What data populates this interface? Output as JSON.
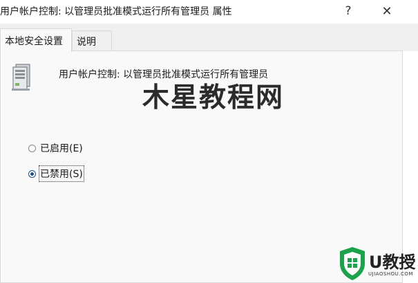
{
  "window": {
    "title": "用户帐户控制: 以管理员批准模式运行所有管理员 属性",
    "help_glyph": "?",
    "close_glyph": "✕"
  },
  "tabs": [
    {
      "label": "本地安全设置",
      "active": true
    },
    {
      "label": "说明",
      "active": false
    }
  ],
  "policy": {
    "icon": "server-icon",
    "name": "用户帐户控制: 以管理员批准模式运行所有管理员"
  },
  "options": [
    {
      "label": "已启用(E)",
      "checked": false
    },
    {
      "label": "已禁用(S)",
      "checked": true
    }
  ],
  "watermark": {
    "text": "木星教程网"
  },
  "logo": {
    "icon": "shield-windows-icon",
    "brand": "U教授",
    "domain": "UJIAOSHOU.COM",
    "color": "#1aa34a"
  }
}
